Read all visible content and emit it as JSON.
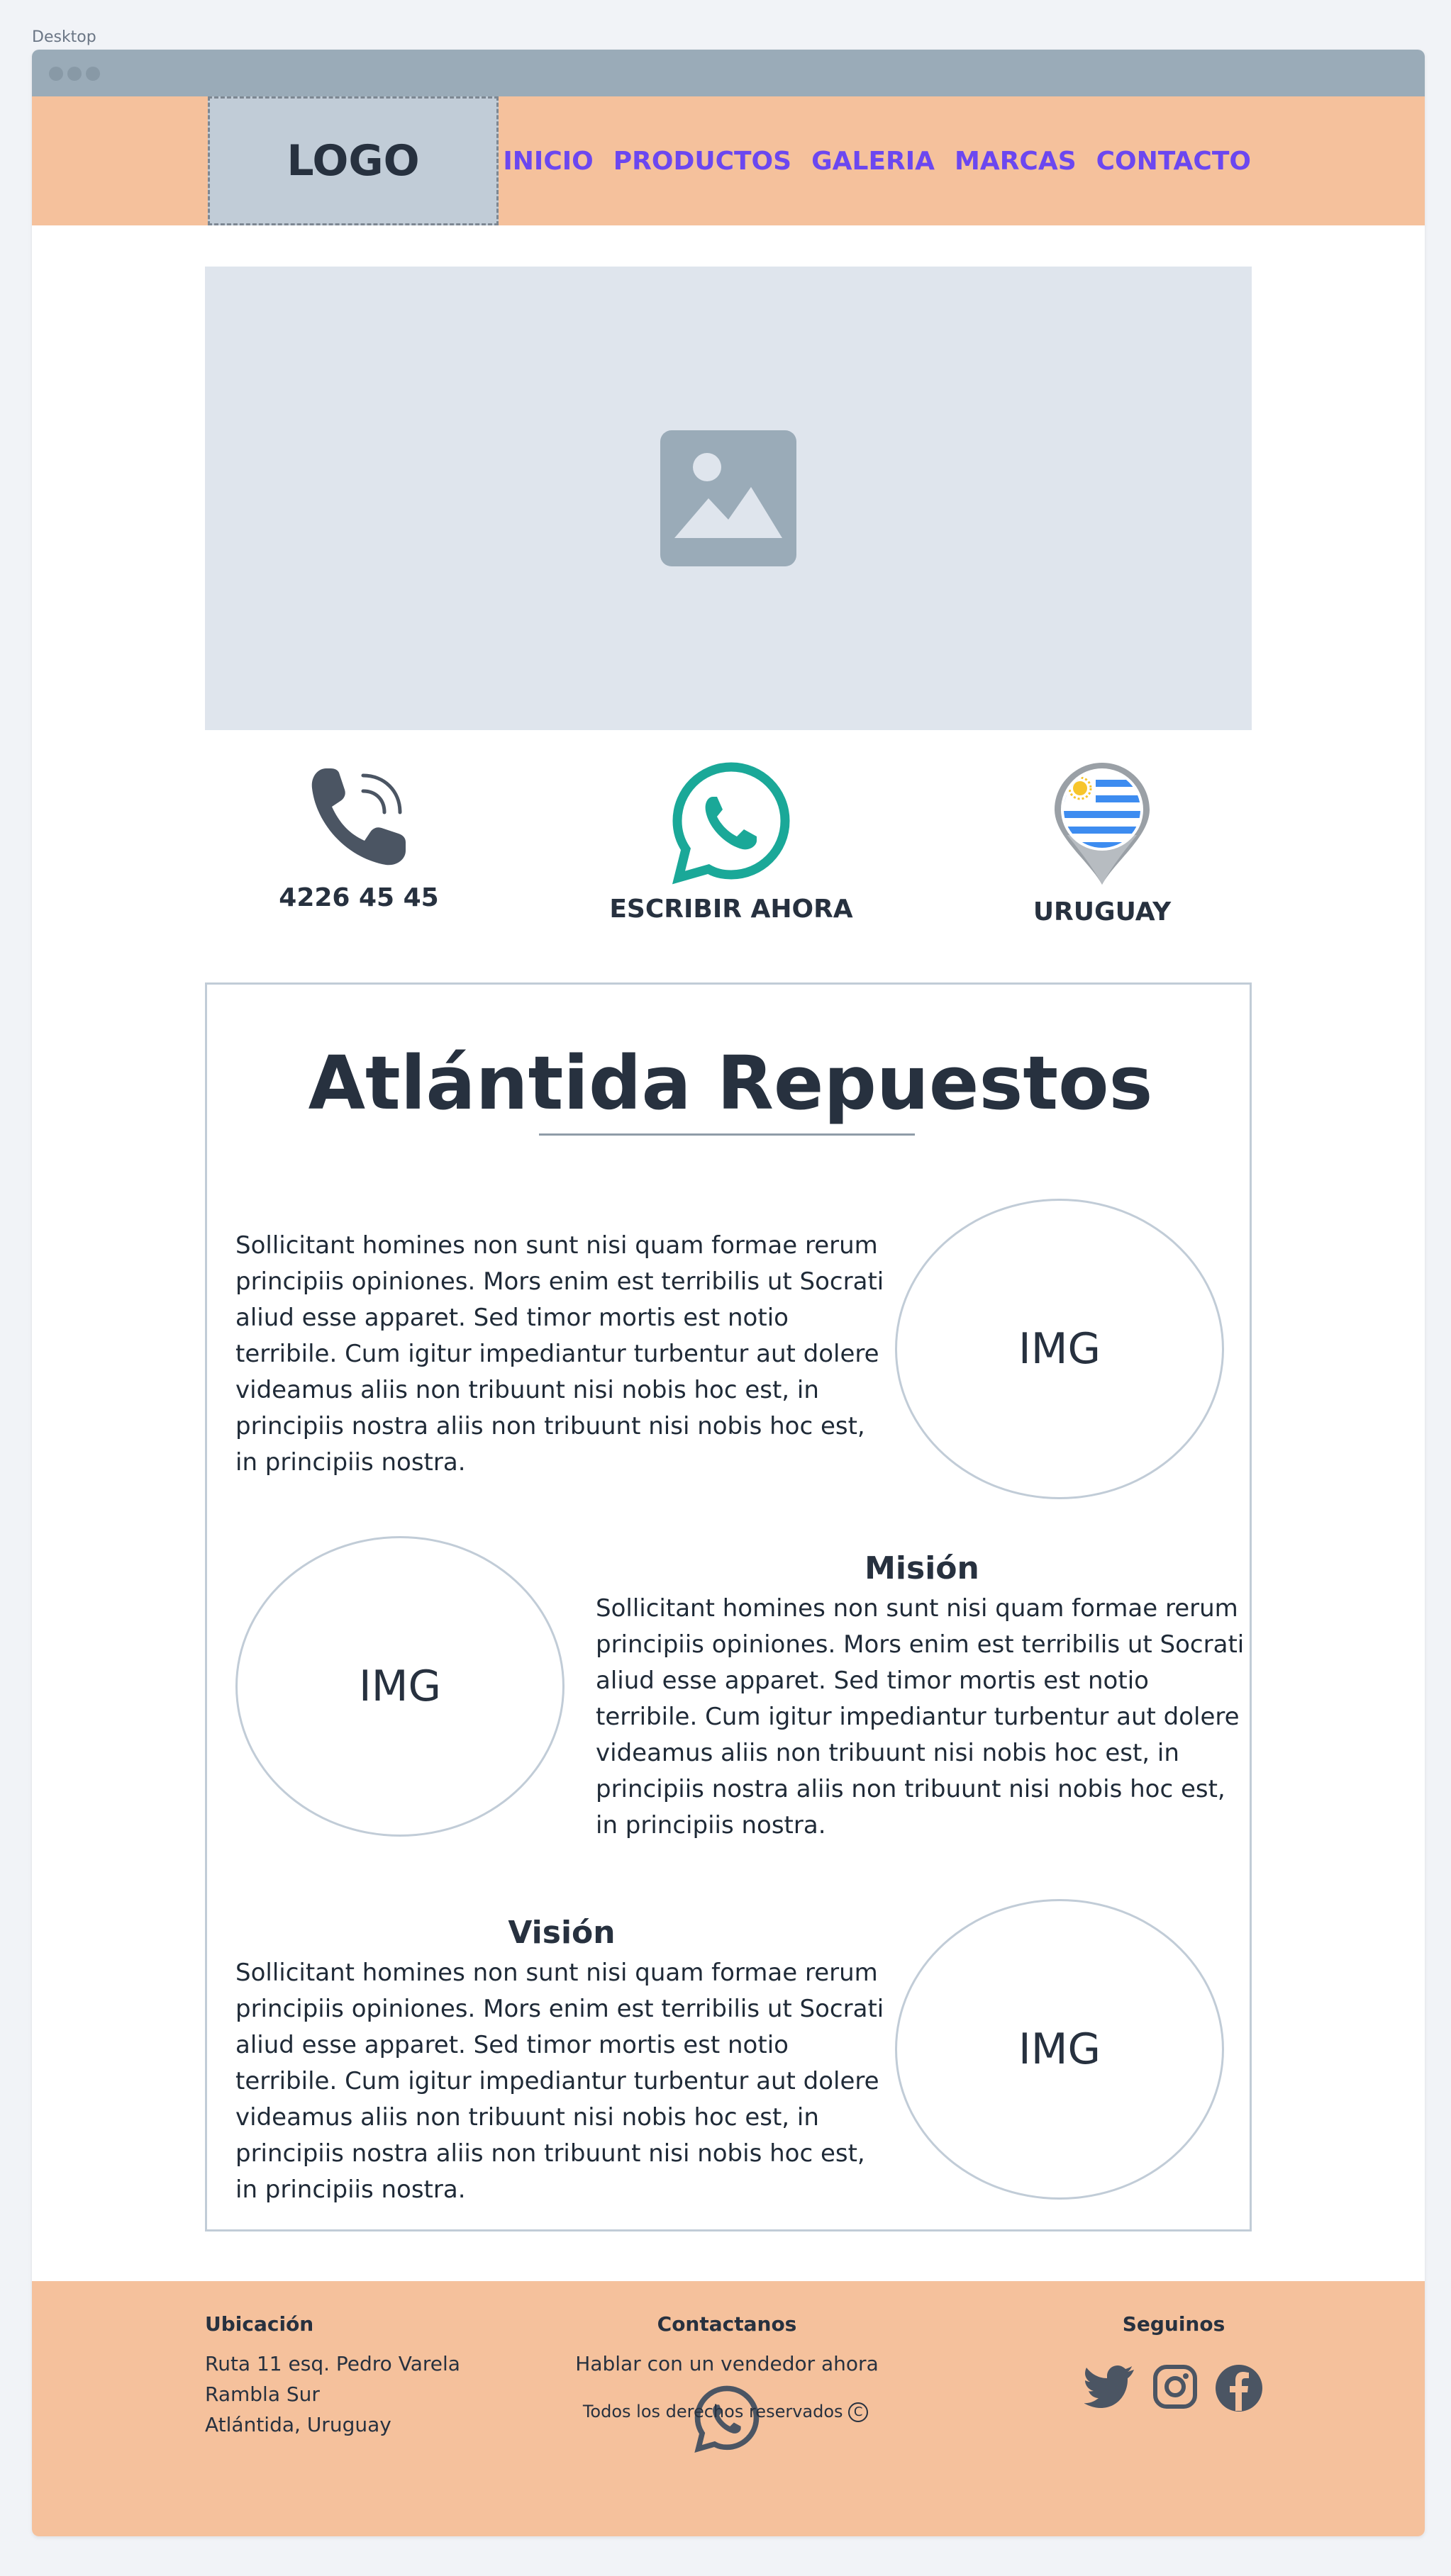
{
  "frame_label": "Desktop",
  "header": {
    "logo_text": "LOGO",
    "nav": [
      "INICIO",
      "PRODUCTOS",
      "GALERIA",
      "MARCAS",
      "CONTACTO"
    ]
  },
  "contact": {
    "phone": "4226 45 45",
    "whatsapp": "ESCRIBIR AHORA",
    "country": "URUGUAY"
  },
  "about": {
    "title": "Atlántida Repuestos",
    "intro": "Sollicitant homines non sunt nisi quam formae rerum principiis opiniones. Mors enim est terribilis ut Socrati aliud esse apparet. Sed timor mortis est notio terribile. Cum igitur impediantur turbentur aut dolere videamus aliis non tribuunt nisi nobis hoc est, in principiis nostra aliis non tribuunt nisi nobis hoc est, in principiis nostra.",
    "mision_title": "Misión",
    "mision_text": "Sollicitant homines non sunt nisi quam formae rerum principiis opiniones. Mors enim est terribilis ut Socrati aliud esse apparet. Sed timor mortis est notio terribile. Cum igitur impediantur turbentur aut dolere videamus aliis non tribuunt nisi nobis hoc est, in principiis nostra aliis non tribuunt nisi nobis hoc est, in principiis nostra.",
    "vision_title": "Visión",
    "vision_text": "Sollicitant homines non sunt nisi quam formae rerum principiis opiniones. Mors enim est terribilis ut Socrati aliud esse apparet. Sed timor mortis est notio terribile. Cum igitur impediantur turbentur aut dolere videamus aliis non tribuunt nisi nobis hoc est, in principiis nostra aliis non tribuunt nisi nobis hoc est, in principiis nostra.",
    "img_label": "IMG"
  },
  "footer": {
    "ubicacion_title": "Ubicación",
    "ubicacion_lines": [
      "Ruta 11 esq. Pedro Varela",
      "Rambla Sur",
      "Atlántida, Uruguay"
    ],
    "contactanos_title": "Contactanos",
    "contactanos_text": "Hablar con un vendedor ahora",
    "seguinos_title": "Seguinos",
    "copyright": "Todos los derechos reservados"
  },
  "icons": {
    "hero": "image-placeholder-icon",
    "phone": "phone-icon",
    "whatsapp": "whatsapp-icon",
    "location": "uruguay-location-pin-icon",
    "social": [
      "twitter-icon",
      "instagram-icon",
      "facebook-icon"
    ]
  },
  "colors": {
    "header_bg": "#f5c19c",
    "nav_link": "#6b47f0",
    "whatsapp_green": "#1aa898",
    "text_dark": "#27313f"
  }
}
